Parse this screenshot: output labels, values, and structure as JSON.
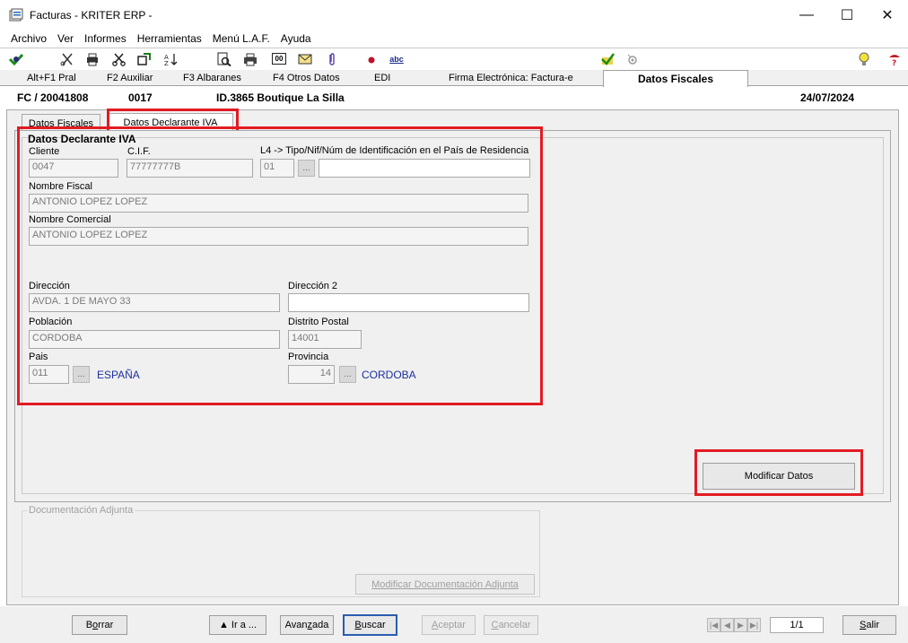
{
  "window": {
    "title": "Facturas - KRITER ERP -",
    "minimize": "—",
    "maximize": "☐",
    "close": "✕"
  },
  "menu": [
    "Archivo",
    "Ver",
    "Informes",
    "Herramientas",
    "Menú L.A.F.",
    "Ayuda"
  ],
  "toolbar": {
    "icons": [
      "exit-icon",
      "scissors-tool-icon",
      "print-icon",
      "cut-icon",
      "refresh-icon",
      "sort-icon",
      "preview-icon",
      "printer-icon",
      "counter-icon",
      "mail-icon",
      "clip-icon",
      "record-icon",
      "spellcheck-icon",
      "checkmark-icon",
      "eye-icon",
      "lightbulb-icon",
      "help-icon"
    ],
    "counter": "00",
    "spell": "abc"
  },
  "fkeys": {
    "items": [
      "Alt+F1 Pral",
      "F2 Auxiliar",
      "F3 Albaranes",
      "F4 Otros Datos",
      "EDI",
      "Firma Electrónica: Factura-e"
    ],
    "active": "Datos Fiscales"
  },
  "doc": {
    "code": "FC / 20041808",
    "serie": "0017",
    "client": "ID.3865 Boutique La Silla",
    "date": "24/07/2024"
  },
  "tabs": {
    "fiscal": "Datos Fiscales",
    "declarante": "Datos Declarante IVA"
  },
  "form": {
    "section_title": "Datos Declarante IVA",
    "cliente_label": "Cliente",
    "cliente_value": "0047",
    "cif_label": "C.I.F.",
    "cif_value": "77777777B",
    "l4_label": "L4 -> Tipo/Nif/Núm de Identificación en el País de Residencia",
    "l4_tipo": "01",
    "l4_num": "",
    "nombre_fiscal_label": "Nombre Fiscal",
    "nombre_fiscal_value": "ANTONIO LOPEZ LOPEZ",
    "nombre_comercial_label": "Nombre Comercial",
    "nombre_comercial_value": "ANTONIO LOPEZ LOPEZ",
    "direccion_label": "Dirección",
    "direccion_value": "AVDA. 1 DE MAYO 33",
    "direccion2_label": "Dirección 2",
    "direccion2_value": "",
    "poblacion_label": "Población",
    "poblacion_value": "CORDOBA",
    "distrito_label": "Distrito Postal",
    "distrito_value": "14001",
    "pais_label": "Pais",
    "pais_code": "011",
    "pais_name": "ESPAÑA",
    "provincia_label": "Provincia",
    "provincia_code": "14",
    "provincia_name": "CORDOBA",
    "dots": "..."
  },
  "buttons": {
    "modificar_datos": "Modificar Datos",
    "doc_legend": "Documentación Adjunta",
    "modificar_doc": "Modificar Documentación Adjunta",
    "borrar_pre": "B",
    "borrar_u": "o",
    "borrar_post": "rrar",
    "ira": "▲  Ir a ...",
    "avanzada_pre": "Avan",
    "avanzada_u": "z",
    "avanzada_post": "ada",
    "buscar_u": "B",
    "buscar_post": "uscar",
    "aceptar_u": "A",
    "aceptar_post": "ceptar",
    "cancelar_u": "C",
    "cancelar_post": "ancelar",
    "salir_u": "S",
    "salir_post": "alir"
  },
  "pager": {
    "first": "|◀",
    "prev": "◀",
    "next": "▶",
    "last": "▶|",
    "position": "1/1"
  }
}
